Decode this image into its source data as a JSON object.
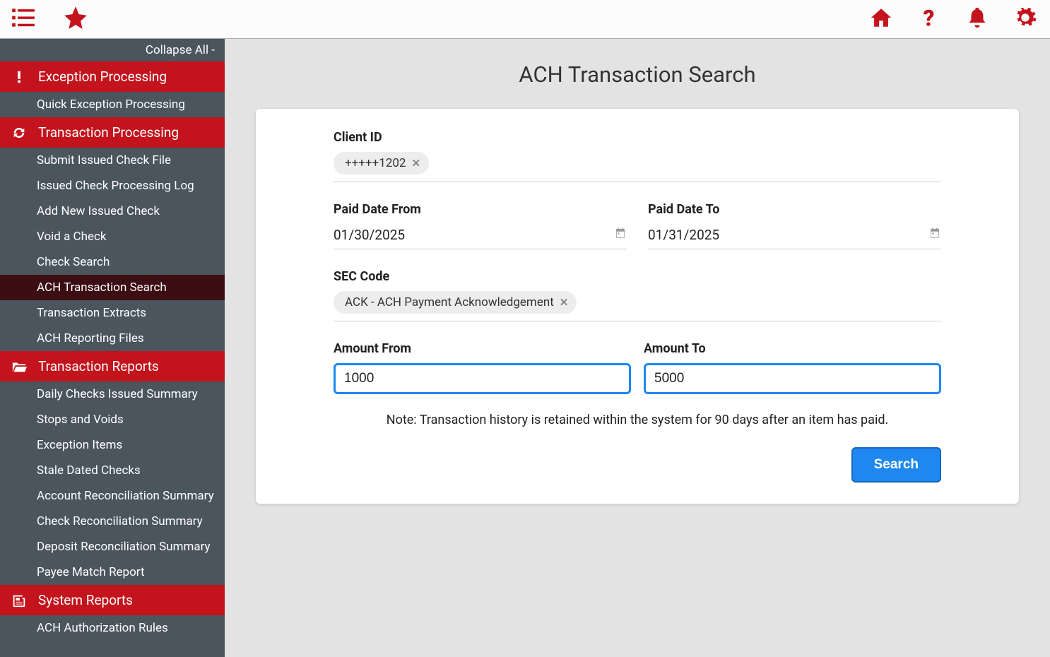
{
  "topbar": {},
  "sidebar": {
    "collapse_label": "Collapse All -",
    "sections": [
      {
        "header": "Exception Processing",
        "items": [
          "Quick Exception Processing"
        ]
      },
      {
        "header": "Transaction Processing",
        "items": [
          "Submit Issued Check File",
          "Issued Check Processing Log",
          "Add New Issued Check",
          "Void a Check",
          "Check Search",
          "ACH Transaction Search",
          "Transaction Extracts",
          "ACH Reporting Files"
        ],
        "active_index": 5
      },
      {
        "header": "Transaction Reports",
        "items": [
          "Daily Checks Issued Summary",
          "Stops and Voids",
          "Exception Items",
          "Stale Dated Checks",
          "Account Reconciliation Summary",
          "Check Reconciliation Summary",
          "Deposit Reconciliation Summary",
          "Payee Match Report"
        ]
      },
      {
        "header": "System Reports",
        "items": [
          "ACH Authorization Rules"
        ]
      }
    ]
  },
  "page": {
    "title": "ACH Transaction Search",
    "client_id_label": "Client ID",
    "client_id_chip": "+++++1202",
    "paid_from_label": "Paid Date From",
    "paid_from_value": "01/30/2025",
    "paid_to_label": "Paid Date To",
    "paid_to_value": "01/31/2025",
    "sec_label": "SEC Code",
    "sec_chip": "ACK - ACH Payment Acknowledgement",
    "amount_from_label": "Amount From",
    "amount_from_value": "1000",
    "amount_to_label": "Amount To",
    "amount_to_value": "5000",
    "note": "Note: Transaction history is retained within the system for 90 days after an item has paid.",
    "search_label": "Search"
  }
}
